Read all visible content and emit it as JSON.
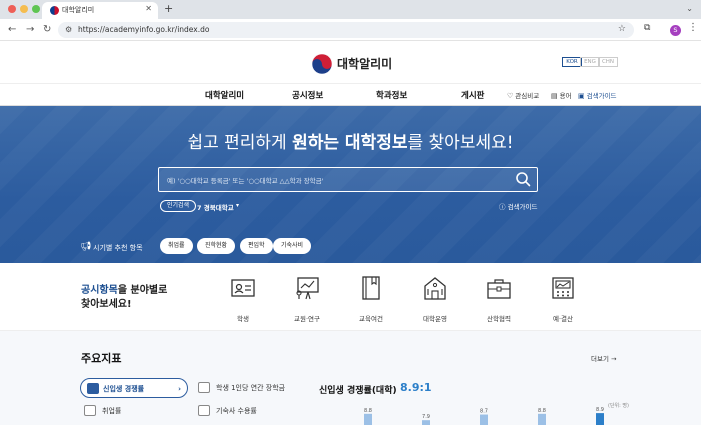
{
  "browser": {
    "tab_title": "대학알리미",
    "url": "https://academyinfo.go.kr/index.do",
    "profile_initial": "S"
  },
  "header": {
    "logo_text": "대학알리미",
    "languages": [
      "KOR",
      "ENG",
      "CHN"
    ],
    "active_language": "KOR"
  },
  "nav": {
    "items": [
      "대학알리미",
      "공시정보",
      "학과정보",
      "게시판"
    ],
    "utilities": [
      "관심비교",
      "용어",
      "검색가이드"
    ]
  },
  "hero": {
    "title_pre": "쉽고 편리하게 ",
    "title_bold": "원하는 대학정보",
    "title_post": "를 찾아보세요!",
    "search_placeholder": "예) '○○대학교 등록금' 또는 '○○대학교 △△학과 장학금'",
    "popular_chip": "인기검색",
    "popular_rank": "7",
    "popular_term": "경북대학교",
    "guide": "검색가이드",
    "season_label": "시기별 추천 항목",
    "topics": [
      "취업률",
      "진학현황",
      "편입학",
      "기숙사비"
    ]
  },
  "categories": {
    "title_em": "공시항목",
    "title_rest": "을 분야별로",
    "title_line2": "찾아보세요!",
    "items": [
      "학생",
      "교원·연구",
      "교육여건",
      "대학운영",
      "산학협력",
      "예·결산"
    ]
  },
  "indicators": {
    "title": "주요지표",
    "more": "더보기 →",
    "tabs": [
      "신입생 경쟁률",
      "학생 1인당 연간 장학금",
      "취업률",
      "기숙사 수용률"
    ],
    "active_tab": "신입생 경쟁률",
    "stat_title": "신입생 경쟁률(대학)",
    "stat_value": "8.9:1",
    "unit": "(단위: 명)"
  },
  "chart_data": {
    "type": "bar",
    "values": [
      8.8,
      7.9,
      8.7,
      8.8,
      8.9
    ],
    "title": "",
    "xlabel": "",
    "ylabel": ""
  },
  "colors": {
    "brand_blue": "#1d4f91",
    "hero_blue": "#2c5c9f",
    "accent": "#2c7fc9"
  }
}
